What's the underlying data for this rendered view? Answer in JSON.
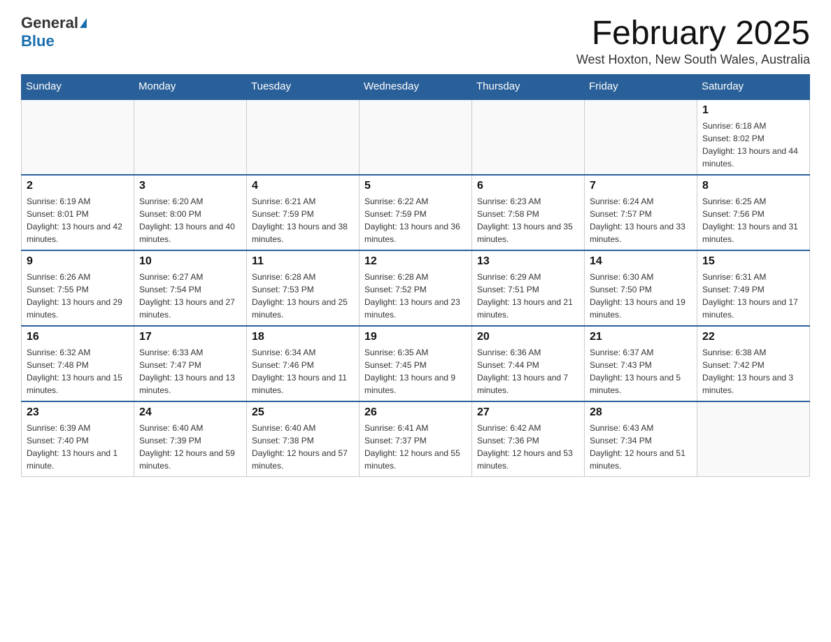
{
  "header": {
    "logo": {
      "general": "General",
      "blue": "Blue",
      "line2": "Blue"
    },
    "title": "February 2025",
    "location": "West Hoxton, New South Wales, Australia"
  },
  "weekdays": [
    "Sunday",
    "Monday",
    "Tuesday",
    "Wednesday",
    "Thursday",
    "Friday",
    "Saturday"
  ],
  "weeks": [
    [
      {
        "day": "",
        "info": ""
      },
      {
        "day": "",
        "info": ""
      },
      {
        "day": "",
        "info": ""
      },
      {
        "day": "",
        "info": ""
      },
      {
        "day": "",
        "info": ""
      },
      {
        "day": "",
        "info": ""
      },
      {
        "day": "1",
        "info": "Sunrise: 6:18 AM\nSunset: 8:02 PM\nDaylight: 13 hours and 44 minutes."
      }
    ],
    [
      {
        "day": "2",
        "info": "Sunrise: 6:19 AM\nSunset: 8:01 PM\nDaylight: 13 hours and 42 minutes."
      },
      {
        "day": "3",
        "info": "Sunrise: 6:20 AM\nSunset: 8:00 PM\nDaylight: 13 hours and 40 minutes."
      },
      {
        "day": "4",
        "info": "Sunrise: 6:21 AM\nSunset: 7:59 PM\nDaylight: 13 hours and 38 minutes."
      },
      {
        "day": "5",
        "info": "Sunrise: 6:22 AM\nSunset: 7:59 PM\nDaylight: 13 hours and 36 minutes."
      },
      {
        "day": "6",
        "info": "Sunrise: 6:23 AM\nSunset: 7:58 PM\nDaylight: 13 hours and 35 minutes."
      },
      {
        "day": "7",
        "info": "Sunrise: 6:24 AM\nSunset: 7:57 PM\nDaylight: 13 hours and 33 minutes."
      },
      {
        "day": "8",
        "info": "Sunrise: 6:25 AM\nSunset: 7:56 PM\nDaylight: 13 hours and 31 minutes."
      }
    ],
    [
      {
        "day": "9",
        "info": "Sunrise: 6:26 AM\nSunset: 7:55 PM\nDaylight: 13 hours and 29 minutes."
      },
      {
        "day": "10",
        "info": "Sunrise: 6:27 AM\nSunset: 7:54 PM\nDaylight: 13 hours and 27 minutes."
      },
      {
        "day": "11",
        "info": "Sunrise: 6:28 AM\nSunset: 7:53 PM\nDaylight: 13 hours and 25 minutes."
      },
      {
        "day": "12",
        "info": "Sunrise: 6:28 AM\nSunset: 7:52 PM\nDaylight: 13 hours and 23 minutes."
      },
      {
        "day": "13",
        "info": "Sunrise: 6:29 AM\nSunset: 7:51 PM\nDaylight: 13 hours and 21 minutes."
      },
      {
        "day": "14",
        "info": "Sunrise: 6:30 AM\nSunset: 7:50 PM\nDaylight: 13 hours and 19 minutes."
      },
      {
        "day": "15",
        "info": "Sunrise: 6:31 AM\nSunset: 7:49 PM\nDaylight: 13 hours and 17 minutes."
      }
    ],
    [
      {
        "day": "16",
        "info": "Sunrise: 6:32 AM\nSunset: 7:48 PM\nDaylight: 13 hours and 15 minutes."
      },
      {
        "day": "17",
        "info": "Sunrise: 6:33 AM\nSunset: 7:47 PM\nDaylight: 13 hours and 13 minutes."
      },
      {
        "day": "18",
        "info": "Sunrise: 6:34 AM\nSunset: 7:46 PM\nDaylight: 13 hours and 11 minutes."
      },
      {
        "day": "19",
        "info": "Sunrise: 6:35 AM\nSunset: 7:45 PM\nDaylight: 13 hours and 9 minutes."
      },
      {
        "day": "20",
        "info": "Sunrise: 6:36 AM\nSunset: 7:44 PM\nDaylight: 13 hours and 7 minutes."
      },
      {
        "day": "21",
        "info": "Sunrise: 6:37 AM\nSunset: 7:43 PM\nDaylight: 13 hours and 5 minutes."
      },
      {
        "day": "22",
        "info": "Sunrise: 6:38 AM\nSunset: 7:42 PM\nDaylight: 13 hours and 3 minutes."
      }
    ],
    [
      {
        "day": "23",
        "info": "Sunrise: 6:39 AM\nSunset: 7:40 PM\nDaylight: 13 hours and 1 minute."
      },
      {
        "day": "24",
        "info": "Sunrise: 6:40 AM\nSunset: 7:39 PM\nDaylight: 12 hours and 59 minutes."
      },
      {
        "day": "25",
        "info": "Sunrise: 6:40 AM\nSunset: 7:38 PM\nDaylight: 12 hours and 57 minutes."
      },
      {
        "day": "26",
        "info": "Sunrise: 6:41 AM\nSunset: 7:37 PM\nDaylight: 12 hours and 55 minutes."
      },
      {
        "day": "27",
        "info": "Sunrise: 6:42 AM\nSunset: 7:36 PM\nDaylight: 12 hours and 53 minutes."
      },
      {
        "day": "28",
        "info": "Sunrise: 6:43 AM\nSunset: 7:34 PM\nDaylight: 12 hours and 51 minutes."
      },
      {
        "day": "",
        "info": ""
      }
    ]
  ]
}
